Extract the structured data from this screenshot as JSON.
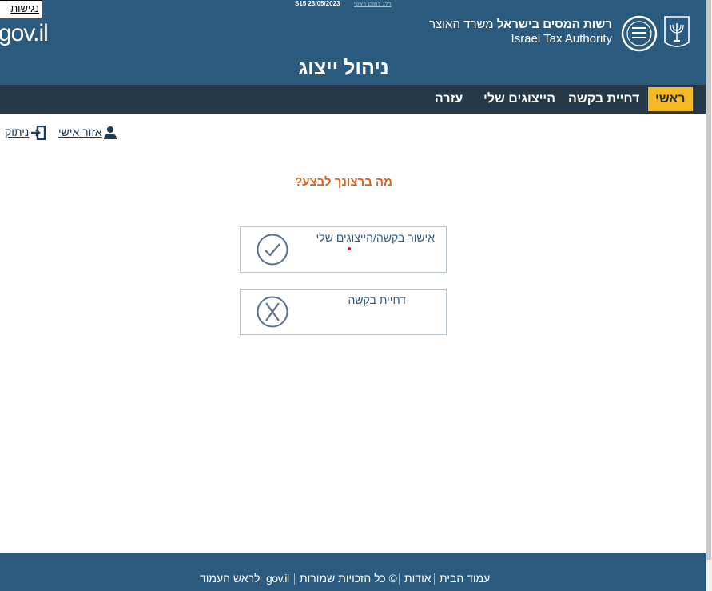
{
  "header": {
    "skip_link": "דלג לתוכן ראשי",
    "version": "S15 23/05/2023",
    "accessibility": "נגישות",
    "govil": "gov.il",
    "authority_he_bold": "רשות המסים בישראל",
    "authority_he_rest": " משרד האוצר",
    "authority_en": "Israel Tax Authority",
    "app_title": "ניהול ייצוג"
  },
  "nav": {
    "items": [
      {
        "label": "ראשי",
        "active": true
      },
      {
        "label": "דחיית בקשה",
        "active": false
      },
      {
        "label": "הייצוגים שלי",
        "active": false
      },
      {
        "label": "עזרה",
        "active": false
      }
    ]
  },
  "user_links": {
    "personal_area": "אזור אישי",
    "logout": "ניתוק"
  },
  "main": {
    "question": "מה ברצונך לבצע?",
    "options": [
      {
        "label": "אישור בקשה/הייצוגים שלי",
        "icon": "check-circle-icon"
      },
      {
        "label": "דחיית בקשה",
        "icon": "x-circle-icon"
      }
    ]
  },
  "footer": {
    "home": "עמוד הבית",
    "about": "אודות",
    "rights": "© כל הזכויות שמורות",
    "govil": "gov.il",
    "top": "לראש העמוד"
  },
  "colors": {
    "header_bg": "#2a5a7e",
    "nav_bg": "#243848",
    "active_tab": "#f7b825",
    "question": "#d9631a",
    "option_text": "#2a5a7e"
  }
}
